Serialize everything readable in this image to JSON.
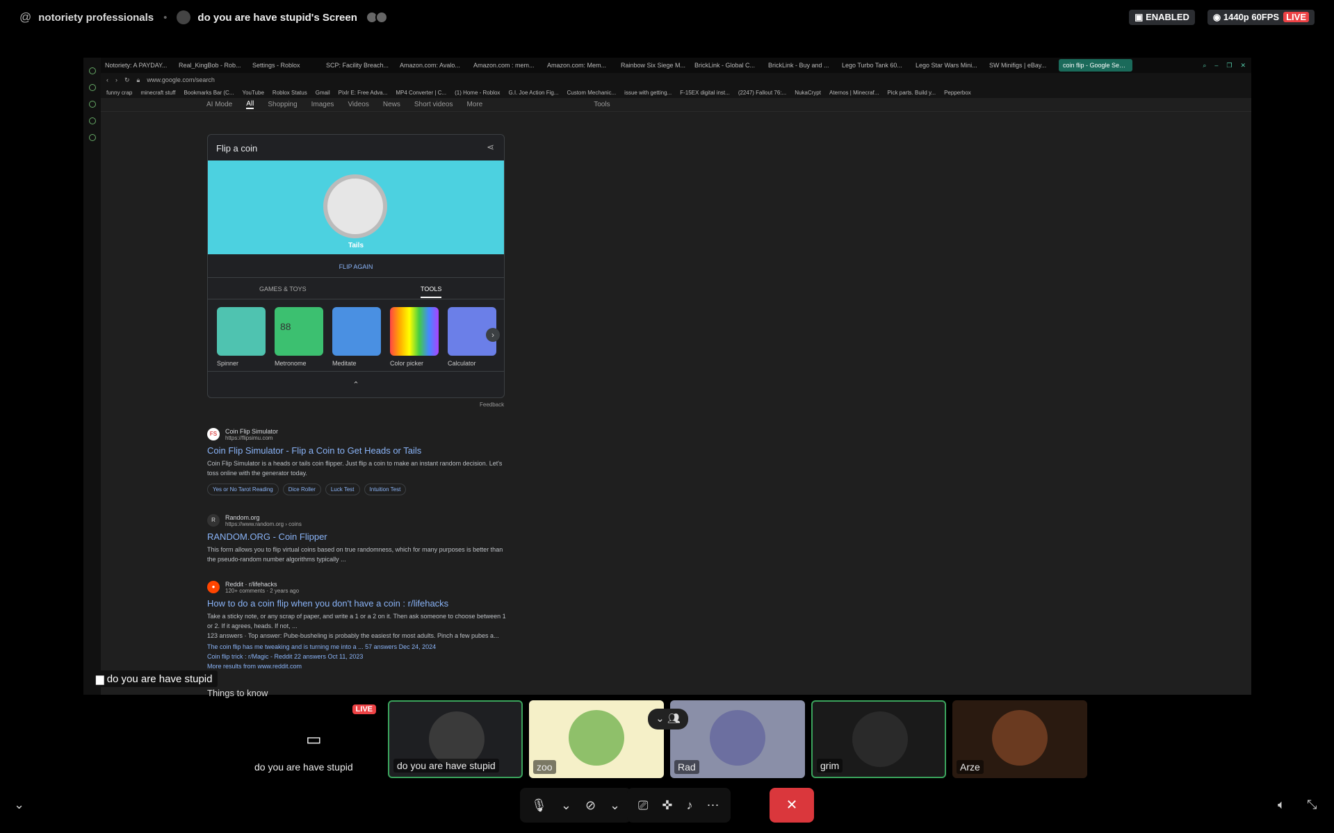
{
  "header": {
    "server": "notoriety professionals",
    "stream_title": "do you are have stupid's Screen",
    "enabled_label": "ENABLED",
    "quality_label": "1440p 60FPS",
    "live_label": "LIVE"
  },
  "browser": {
    "tabs": [
      "Notoriety: A PAYDAY...",
      "Real_KingBob - Rob...",
      "Settings - Roblox",
      "SCP: Facility Breach...",
      "Amazon.com: Avalo...",
      "Amazon.com : mem...",
      "Amazon.com: Mem...",
      "Rainbow Six Siege M...",
      "BrickLink - Global C...",
      "BrickLink - Buy and ...",
      "Lego Turbo Tank 60...",
      "Lego Star Wars Mini...",
      "SW Minifigs | eBay...",
      "coin flip - Google Search"
    ],
    "url": "www.google.com/search",
    "bookmarks": [
      "funny crap",
      "minecraft stuff",
      "Bookmarks Bar (C...",
      "YouTube",
      "Roblox Status",
      "Gmail",
      "Pixlr E: Free Adva...",
      "MP4 Converter | C...",
      "(1) Home - Roblox",
      "G.I. Joe Action Fig...",
      "Custom Mechanic...",
      "issue with getting...",
      "F-15EX digital inst...",
      "(2247) Fallout 76:...",
      "NukaCrypt",
      "Aternos | Minecraf...",
      "Pick parts. Build y...",
      "Pepperbox"
    ]
  },
  "google": {
    "nav": [
      "AI Mode",
      "All",
      "Shopping",
      "Images",
      "Videos",
      "News",
      "Short videos",
      "More"
    ],
    "tools": "Tools",
    "card": {
      "title": "Flip a coin",
      "result": "Tails",
      "flip_again": "FLIP AGAIN",
      "tab_games": "GAMES & TOYS",
      "tab_tools": "TOOLS",
      "tools": [
        "Spinner",
        "Metronome",
        "Meditate",
        "Color picker",
        "Calculator"
      ],
      "metronome_value": "88",
      "feedback": "Feedback"
    },
    "results": [
      {
        "site": "Coin Flip Simulator",
        "url": "https://flipsimu.com",
        "title": "Coin Flip Simulator - Flip a Coin to Get Heads or Tails",
        "snippet": "Coin Flip Simulator is a heads or tails coin flipper. Just flip a coin to make an instant random decision. Let's toss online with the generator today.",
        "chips": [
          "Yes or No Tarot Reading",
          "Dice Roller",
          "Luck Test",
          "Intuition Test"
        ]
      },
      {
        "site": "Random.org",
        "url": "https://www.random.org › coins",
        "title": "RANDOM.ORG - Coin Flipper",
        "snippet": "This form allows you to flip virtual coins based on true randomness, which for many purposes is better than the pseudo-random number algorithms typically ..."
      },
      {
        "site": "Reddit · r/lifehacks",
        "url": "120+ comments · 2 years ago",
        "title": "How to do a coin flip when you don't have a coin : r/lifehacks",
        "snippet": "Take a sticky note, or any scrap of paper, and write a 1 or a 2 on it. Then ask someone to choose between 1 or 2. If it agrees, heads. If not, ...",
        "answers": "123 answers · Top answer: Pube-busheling is probably the easiest for most adults. Pinch a few pubes a...",
        "sub1": "The coin flip has me tweaking and is turning me into a ...   57 answers   Dec 24, 2024",
        "sub2": "Coin flip trick : r/Magic - Reddit   22 answers   Oct 11, 2023",
        "more": "More results from www.reddit.com"
      }
    ],
    "things_to_know": "Things to know"
  },
  "stream_label": "do you are have stupid",
  "participants": [
    {
      "name": "do you are have stupid",
      "live": "LIVE"
    },
    {
      "name": "do you are have stupid"
    },
    {
      "name": "zoo"
    },
    {
      "name": "Rad"
    },
    {
      "name": "grim"
    },
    {
      "name": "Arze"
    }
  ]
}
